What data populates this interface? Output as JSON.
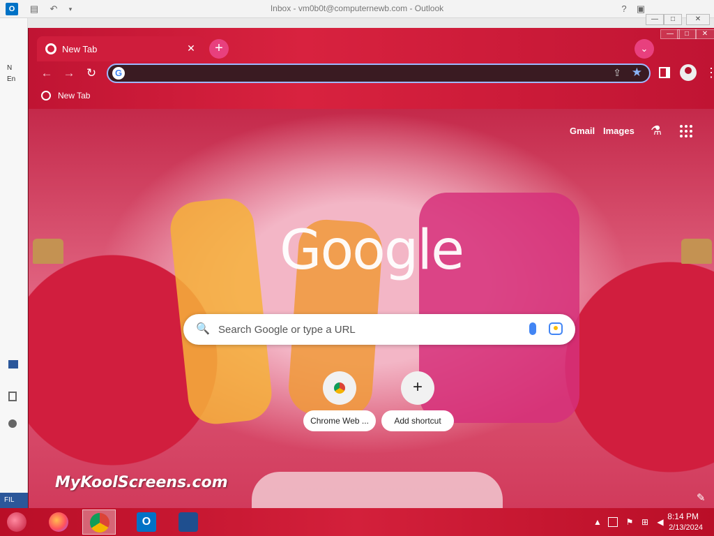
{
  "outlook": {
    "title": "Inbox - vm0b0t@computernewb.com - Outlook",
    "app_icon": "O",
    "undo": "↶",
    "status_text": "FIL",
    "help": "?",
    "side_letters": [
      "N",
      "En"
    ]
  },
  "chrome": {
    "tab_title": "New Tab",
    "tab_close": "✕",
    "new_tab": "+",
    "tab_search": "⌄",
    "nav": {
      "back": "←",
      "forward": "→",
      "reload": "↻"
    },
    "omnibox_value": "",
    "share": "⇪",
    "star": "★",
    "menu": "⋮",
    "bookmark": "New Tab",
    "window_controls": {
      "minimize": "—",
      "maximize": "□",
      "close": "✕"
    }
  },
  "ntp": {
    "gmail": "Gmail",
    "images": "Images",
    "labs": "⚗",
    "logo": "Google",
    "search_placeholder": "Search Google or type a URL",
    "search_icon": "🔍",
    "shortcuts": [
      {
        "label": "Chrome Web ...",
        "icon": "chrome-web-store-icon"
      },
      {
        "label": "Add shortcut",
        "icon": "+"
      }
    ],
    "edit": "✎",
    "watermark": "MyKoolScreens.com"
  },
  "taskbar": {
    "apps": [
      "firefox-icon",
      "chrome-icon",
      "outlook-icon",
      "virtualbox-icon"
    ],
    "outlook_glyph": "O",
    "time": "8:14 PM",
    "date": "2/13/2024",
    "tray_up": "▲"
  },
  "colors": {
    "accent": "#b3122c",
    "omnibox_border": "#9fb8ff"
  }
}
